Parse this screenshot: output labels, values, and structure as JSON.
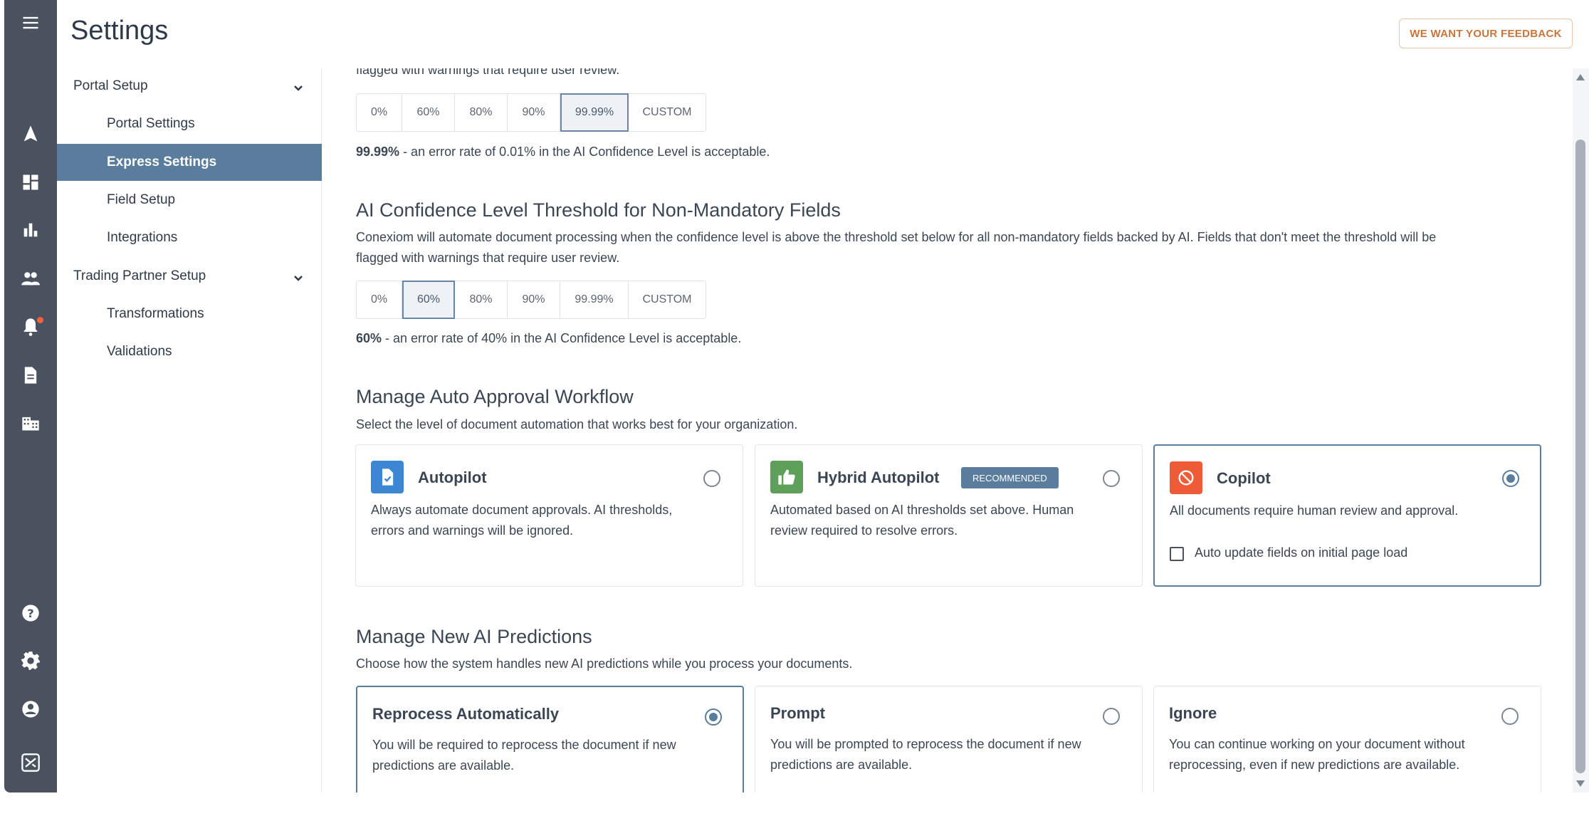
{
  "header": {
    "title": "Settings",
    "feedback_label": "WE WANT YOUR FEEDBACK"
  },
  "rail": {
    "icons": [
      "menu-icon",
      "navigate-icon",
      "dashboard-icon",
      "bar-chart-icon",
      "users-icon",
      "bell-icon",
      "document-icon",
      "building-icon",
      "help-icon",
      "gear-icon",
      "account-icon",
      "app-logo-icon"
    ]
  },
  "nav": {
    "groups": [
      {
        "label": "Portal Setup",
        "items": [
          "Portal Settings",
          "Express Settings",
          "Field Setup",
          "Integrations"
        ]
      },
      {
        "label": "Trading Partner Setup",
        "items": [
          "Transformations",
          "Validations"
        ]
      }
    ],
    "active": "Express Settings"
  },
  "mandatory": {
    "desc_tail": "flagged with warnings that require user review.",
    "options": [
      "0%",
      "60%",
      "80%",
      "90%",
      "99.99%",
      "CUSTOM"
    ],
    "selected": "99.99%",
    "note_value": "99.99%",
    "note_text": " - an error rate of 0.01% in the AI Confidence Level is acceptable."
  },
  "non_mandatory": {
    "title": "AI Confidence Level Threshold for Non-Mandatory Fields",
    "desc_line1": "Conexiom will automate document processing when the confidence level is above the threshold set below for all non-mandatory fields backed by AI. Fields that don't meet the threshold will be",
    "desc_line2": "flagged with warnings that require user review.",
    "options": [
      "0%",
      "60%",
      "80%",
      "90%",
      "99.99%",
      "CUSTOM"
    ],
    "selected": "60%",
    "note_value": "60%",
    "note_text": " - an error rate of 40% in the AI Confidence Level is acceptable."
  },
  "approval": {
    "title": "Manage Auto Approval Workflow",
    "desc": "Select the level of document automation that works best for your organization.",
    "cards": [
      {
        "title": "Autopilot",
        "line1": "Always automate document approvals. AI thresholds,",
        "line2": "errors and warnings will be ignored.",
        "selected": false,
        "color": "#3d86d4"
      },
      {
        "title": "Hybrid Autopilot",
        "badge": "RECOMMENDED",
        "line1": "Automated based on AI thresholds set above. Human",
        "line2": "review required to resolve errors.",
        "selected": false,
        "color": "#5e9f5a"
      },
      {
        "title": "Copilot",
        "line1": "All documents require human review and approval.",
        "checkbox_label": "Auto update fields on initial page load",
        "selected": true,
        "color": "#ef5b36"
      }
    ]
  },
  "predictions": {
    "title": "Manage New AI Predictions",
    "desc": "Choose how the system handles new AI predictions while you process your documents.",
    "cards": [
      {
        "title": "Reprocess Automatically",
        "line1": "You will be required to reprocess the document if new",
        "line2": "predictions are available.",
        "selected": true
      },
      {
        "title": "Prompt",
        "line1": "You will be prompted to reprocess the document if new",
        "line2": "predictions are available.",
        "selected": false
      },
      {
        "title": "Ignore",
        "line1": "You can continue working on your document without",
        "line2": "reprocessing, even if new predictions are available.",
        "selected": false
      }
    ]
  }
}
